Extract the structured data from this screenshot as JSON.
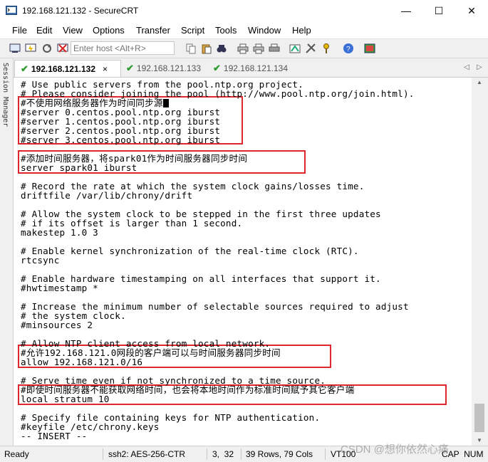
{
  "window": {
    "title": "192.168.121.132 - SecureCRT",
    "minimize": "—",
    "maximize": "☐",
    "close": "✕"
  },
  "menu": [
    "File",
    "Edit",
    "View",
    "Options",
    "Transfer",
    "Script",
    "Tools",
    "Window",
    "Help"
  ],
  "toolbar": {
    "host_placeholder": "Enter host <Alt+R>"
  },
  "session_manager": {
    "label": "Session Manager"
  },
  "tabs": [
    {
      "label": "192.168.121.132",
      "active": true,
      "close": "×"
    },
    {
      "label": "192.168.121.133",
      "active": false
    },
    {
      "label": "192.168.121.134",
      "active": false
    }
  ],
  "tab_nav": {
    "prev": "◁",
    "next": "▷"
  },
  "terminal": {
    "lines": [
      "# Use public servers from the pool.ntp.org project.",
      "# Please consider joining the pool (http://www.pool.ntp.org/join.html).",
      "#不使用网络服务器作为时间同步源",
      "#server 0.centos.pool.ntp.org iburst",
      "#server 1.centos.pool.ntp.org iburst",
      "#server 2.centos.pool.ntp.org iburst",
      "#server 3.centos.pool.ntp.org iburst",
      "",
      "#添加时间服务器，将spark01作为时间服务器同步时间",
      "server spark01 iburst",
      "",
      "# Record the rate at which the system clock gains/losses time.",
      "driftfile /var/lib/chrony/drift",
      "",
      "# Allow the system clock to be stepped in the first three updates",
      "# if its offset is larger than 1 second.",
      "makestep 1.0 3",
      "",
      "# Enable kernel synchronization of the real-time clock (RTC).",
      "rtcsync",
      "",
      "# Enable hardware timestamping on all interfaces that support it.",
      "#hwtimestamp *",
      "",
      "# Increase the minimum number of selectable sources required to adjust",
      "# the system clock.",
      "#minsources 2",
      "",
      "# Allow NTP client access from local network.",
      "#允许192.168.121.0网段的客户端可以与时间服务器同步时间",
      "allow 192.168.121.0/16",
      "",
      "# Serve time even if not synchronized to a time source.",
      "#即使时间服务器不能获取网络时间，也会将本地时间作为标准时间赋予其它客户端",
      "local stratum 10",
      "",
      "# Specify file containing keys for NTP authentication.",
      "#keyfile /etc/chrony.keys",
      "-- INSERT --"
    ]
  },
  "status": {
    "ready": "Ready",
    "protocol": "ssh2: AES-256-CTR",
    "cursor_pos": "3,  32",
    "size": "39 Rows, 79 Cols",
    "term": "VT100",
    "num": "CAP  NUM"
  },
  "watermark": "CSDN @想你依然心痛",
  "colors": {
    "highlight_box": "#e0262d",
    "tab_check": "#2e9b2e"
  }
}
